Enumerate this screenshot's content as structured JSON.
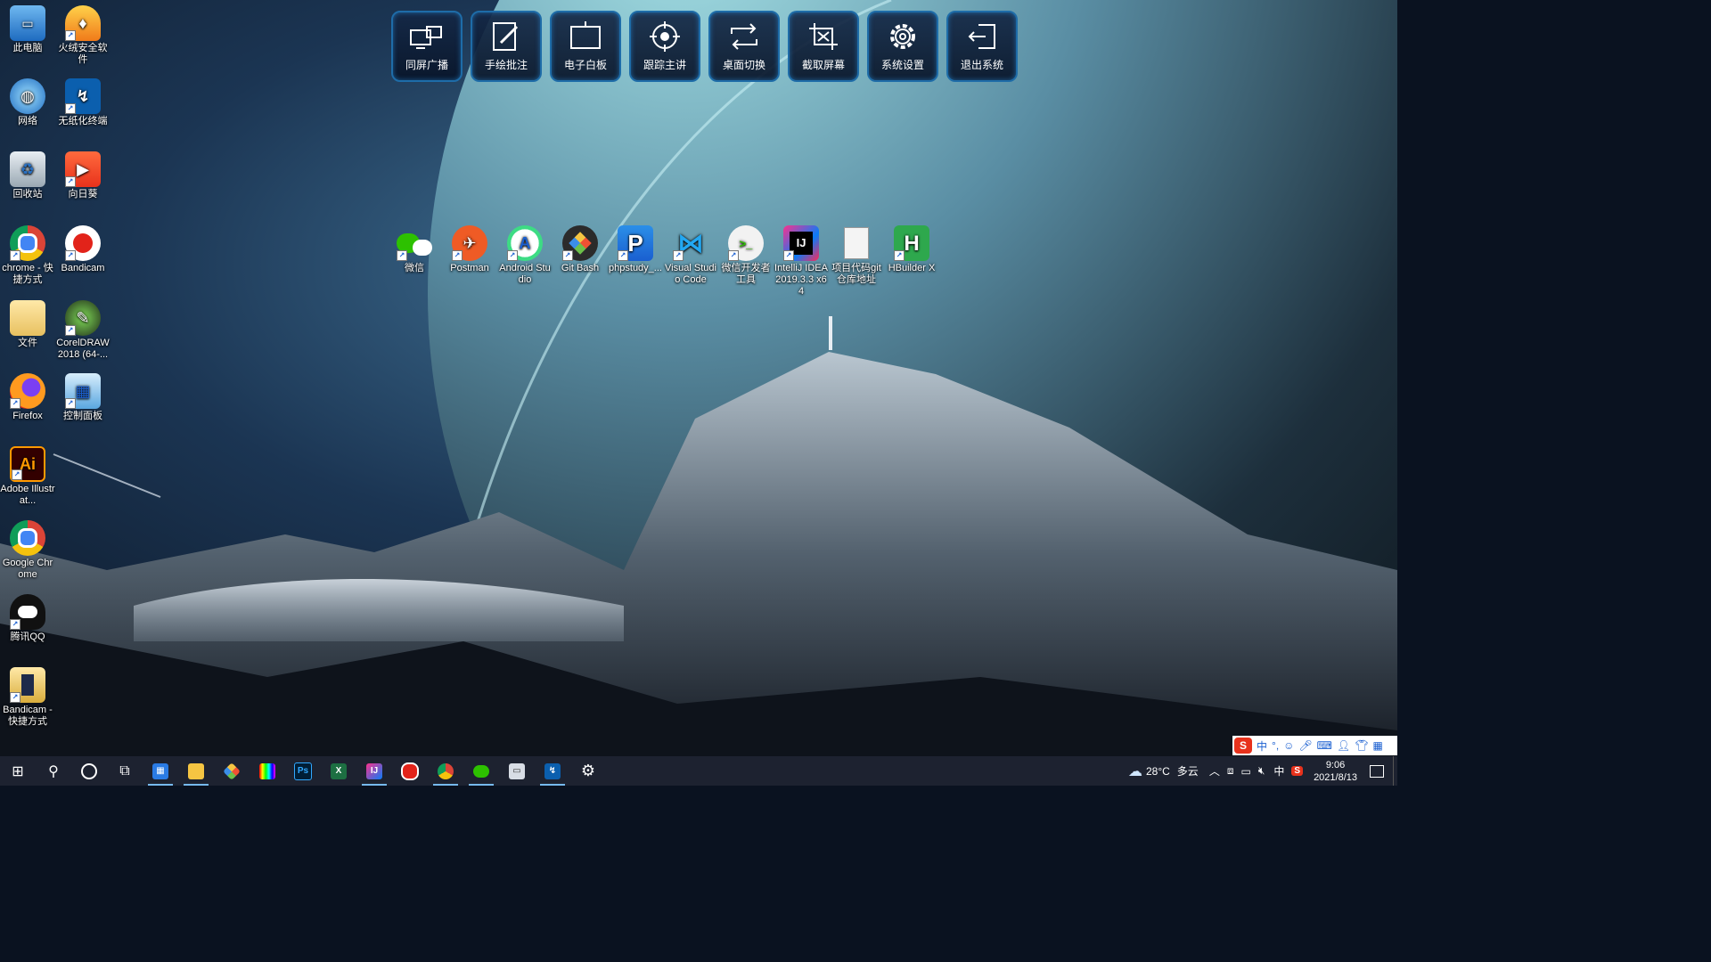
{
  "toolbar": [
    {
      "label": "同屏广播",
      "icon": "screen-broadcast-icon"
    },
    {
      "label": "手绘批注",
      "icon": "annotate-icon"
    },
    {
      "label": "电子白板",
      "icon": "whiteboard-icon"
    },
    {
      "label": "跟踪主讲",
      "icon": "track-speaker-icon"
    },
    {
      "label": "桌面切换",
      "icon": "desktop-switch-icon"
    },
    {
      "label": "截取屏幕",
      "icon": "screenshot-crop-icon"
    },
    {
      "label": "系统设置",
      "icon": "gear-icon"
    },
    {
      "label": "退出系统",
      "icon": "exit-icon"
    }
  ],
  "desktop_left": [
    {
      "label": "此电脑",
      "icon": "this-pc-icon"
    },
    {
      "label": "火绒安全软件",
      "icon": "huorong-icon"
    },
    {
      "label": "网络",
      "icon": "network-icon"
    },
    {
      "label": "无纸化终端",
      "icon": "paperless-terminal-icon"
    },
    {
      "label": "回收站",
      "icon": "recycle-bin-icon"
    },
    {
      "label": "向日葵",
      "icon": "sunflower-remote-icon"
    },
    {
      "label": "chrome - 快捷方式",
      "icon": "chrome-icon"
    },
    {
      "label": "Bandicam",
      "icon": "bandicam-icon"
    },
    {
      "label": "文件",
      "icon": "folder-icon"
    },
    {
      "label": "CorelDRAW 2018 (64-...",
      "icon": "coreldraw-icon"
    },
    {
      "label": "Firefox",
      "icon": "firefox-icon"
    },
    {
      "label": "控制面板",
      "icon": "control-panel-icon"
    },
    {
      "label": "Adobe Illustrat...",
      "icon": "illustrator-icon"
    },
    {
      "label": "Google Chrome",
      "icon": "chrome-icon"
    },
    {
      "label": "腾讯QQ",
      "icon": "qq-icon"
    },
    {
      "label": "Bandicam - 快捷方式",
      "icon": "bandicam-folder-icon"
    }
  ],
  "desktop_row": [
    {
      "label": "微信",
      "icon": "wechat-icon"
    },
    {
      "label": "Postman",
      "icon": "postman-icon"
    },
    {
      "label": "Android Studio",
      "icon": "android-studio-icon"
    },
    {
      "label": "Git Bash",
      "icon": "git-bash-icon"
    },
    {
      "label": "phpstudy_...",
      "icon": "phpstudy-icon"
    },
    {
      "label": "Visual Studio Code",
      "icon": "vscode-icon"
    },
    {
      "label": "微信开发者工具",
      "icon": "wechat-devtools-icon"
    },
    {
      "label": "IntelliJ IDEA 2019.3.3 x64",
      "icon": "intellij-icon"
    },
    {
      "label": "项目代码git仓库地址",
      "icon": "text-file-icon"
    },
    {
      "label": "HBuilder X",
      "icon": "hbuilder-icon"
    }
  ],
  "taskbar": {
    "apps": [
      "windows-start-icon",
      "search-icon",
      "cortana-icon",
      "task-view-icon",
      "calendar-app-icon",
      "file-explorer-icon",
      "git-app-icon",
      "color-app-icon",
      "photoshop-icon",
      "excel-icon",
      "intellij-icon",
      "record-icon",
      "chrome-icon",
      "wechat-icon",
      "remote-screen-icon",
      "terminal-app-icon",
      "settings-gear-icon"
    ],
    "weather": "28°C",
    "weather_desc": "多云",
    "lang": "中",
    "time": "9:06",
    "date": "2021/8/13"
  },
  "ime": {
    "lang": "中"
  },
  "colors": {
    "accent": "#1e6ca8",
    "taskbar": "#1d2230"
  }
}
